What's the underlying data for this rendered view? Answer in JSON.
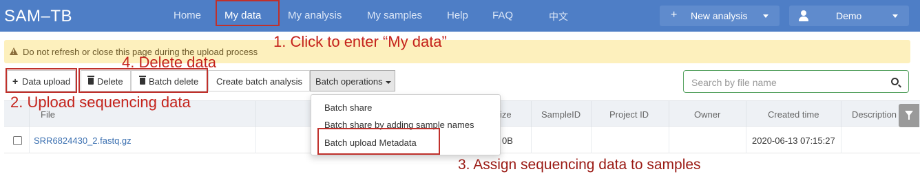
{
  "navbar": {
    "brand": "SAM–TB",
    "items": [
      {
        "label": "Home"
      },
      {
        "label": "My data"
      },
      {
        "label": "My analysis"
      },
      {
        "label": "My samples"
      },
      {
        "label": "Help"
      },
      {
        "label": "FAQ"
      },
      {
        "label": "中文"
      }
    ],
    "active_item": "My data",
    "new_analysis_label": "New analysis",
    "user_label": "Demo"
  },
  "alert": {
    "text": "Do not refresh or close this page during the upload process"
  },
  "toolbar": {
    "data_upload": "Data upload",
    "delete": "Delete",
    "batch_delete": "Batch delete",
    "create_batch_analysis": "Create batch analysis",
    "batch_operations": "Batch operations"
  },
  "search": {
    "placeholder": "Search by file name"
  },
  "table": {
    "columns": [
      "File",
      "ize",
      "SampleID",
      "Project ID",
      "Owner",
      "Created time",
      "Description"
    ],
    "rows": [
      {
        "file": "SRR6824430_2.fastq.gz",
        "size": "0B",
        "sample_id": "",
        "project_id": "",
        "owner": "",
        "created_time": "2020-06-13 07:15:27",
        "description": ""
      }
    ]
  },
  "batch_menu": {
    "items": [
      "Batch share",
      "Batch share by adding sample names",
      "Batch upload Metadata"
    ]
  },
  "annotations": {
    "step1": "1. Click to enter “My data”",
    "step2": "2. Upload sequencing data",
    "step3": "3. Assign sequencing data to samples",
    "step4": "4. Delete data"
  },
  "colors": {
    "navbar": "#4e7ec6",
    "alert_bg": "#fdf0bd",
    "annotation_red": "#c4221b",
    "search_border": "#5aa464"
  },
  "icons": [
    "plus-icon",
    "user-icon",
    "caret-down-icon",
    "warning-icon",
    "trash-icon",
    "search-icon",
    "filter-icon"
  ]
}
